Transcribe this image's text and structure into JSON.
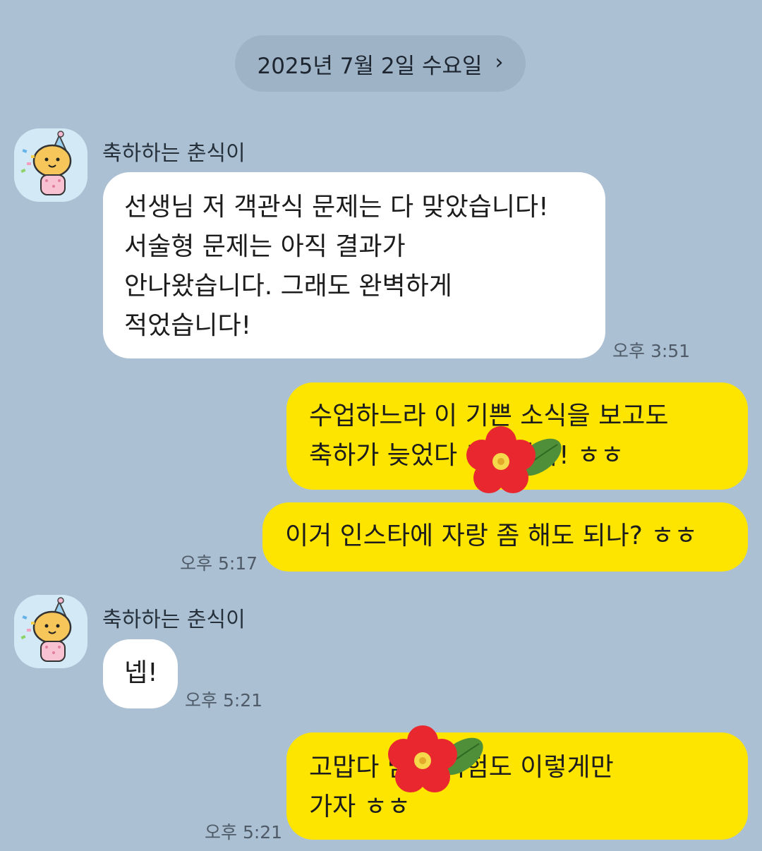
{
  "header": {
    "date_label": "2025년 7월 2일 수요일",
    "chevron_icon": "chevron-right-icon"
  },
  "messages": [
    {
      "sender": "축하하는 춘식이",
      "text": "선생님 저 객관식 문제는 다 맞았습니다!\n서술형 문제는 아직 결과가\n안나왔습니다. 그래도 완벽하게\n적었습니다!",
      "time": "오후 3:51"
    },
    {
      "text": "수업하느라 이 기쁜 소식을 보고도\n축하가 늦었다 축하한다! ㅎㅎ"
    },
    {
      "text": "이거 인스타에 자랑 좀 해도 되나? ㅎㅎ",
      "time": "오후 5:17"
    },
    {
      "sender": "축하하는 춘식이",
      "text": "넵!",
      "time": "오후 5:21"
    },
    {
      "text": "고맙다 남은 시험도 이렇게만\n가자 ㅎㅎ",
      "time": "오후 5:21"
    }
  ],
  "colors": {
    "background": "#abc0d3",
    "incoming_bubble": "#ffffff",
    "outgoing_bubble": "#fee500",
    "date_pill": "#9fb3c6"
  }
}
